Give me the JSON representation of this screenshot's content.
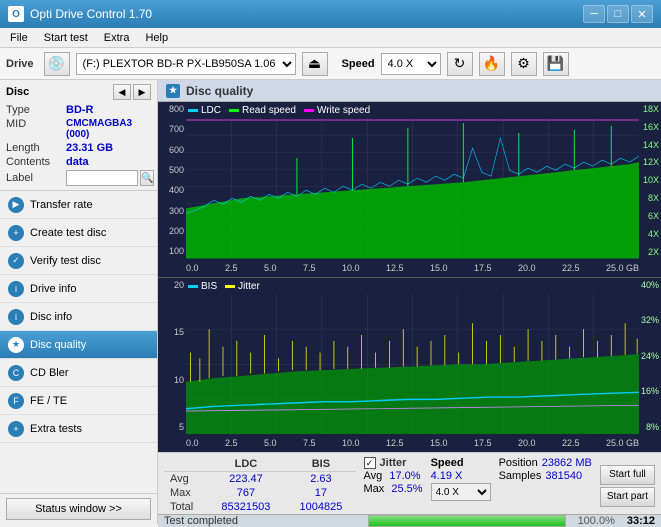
{
  "titlebar": {
    "title": "Opti Drive Control 1.70",
    "min_btn": "─",
    "max_btn": "□",
    "close_btn": "✕"
  },
  "menubar": {
    "items": [
      "File",
      "Start test",
      "Extra",
      "Help"
    ]
  },
  "toolbar": {
    "drive_label": "Drive",
    "drive_value": "(F:)  PLEXTOR BD-R  PX-LB950SA 1.06",
    "speed_label": "Speed",
    "speed_value": "4.0 X"
  },
  "disc": {
    "title": "Disc",
    "type_label": "Type",
    "type_value": "BD-R",
    "mid_label": "MID",
    "mid_value": "CMCMAGBA3 (000)",
    "length_label": "Length",
    "length_value": "23.31 GB",
    "contents_label": "Contents",
    "contents_value": "data",
    "label_label": "Label",
    "label_value": ""
  },
  "nav": {
    "items": [
      {
        "id": "transfer-rate",
        "label": "Transfer rate",
        "active": false
      },
      {
        "id": "create-test-disc",
        "label": "Create test disc",
        "active": false
      },
      {
        "id": "verify-test-disc",
        "label": "Verify test disc",
        "active": false
      },
      {
        "id": "drive-info",
        "label": "Drive info",
        "active": false
      },
      {
        "id": "disc-info",
        "label": "Disc info",
        "active": false
      },
      {
        "id": "disc-quality",
        "label": "Disc quality",
        "active": true
      },
      {
        "id": "cd-bler",
        "label": "CD Bler",
        "active": false
      },
      {
        "id": "fe-te",
        "label": "FE / TE",
        "active": false
      },
      {
        "id": "extra-tests",
        "label": "Extra tests",
        "active": false
      }
    ]
  },
  "status": {
    "btn_label": "Status window >>",
    "status_text": "Test completed",
    "progress_pct": 100,
    "time": "33:12"
  },
  "chart": {
    "title": "Disc quality",
    "top": {
      "legend": [
        {
          "id": "ldc",
          "label": "LDC",
          "color": "#00ccff"
        },
        {
          "id": "read-speed",
          "label": "Read speed",
          "color": "#00ff00"
        },
        {
          "id": "write-speed",
          "label": "Write speed",
          "color": "#ff00ff"
        }
      ],
      "y_left": [
        "800",
        "700",
        "600",
        "500",
        "400",
        "300",
        "200",
        "100"
      ],
      "y_right": [
        "18X",
        "16X",
        "14X",
        "12X",
        "10X",
        "8X",
        "6X",
        "4X",
        "2X"
      ],
      "x_labels": [
        "0.0",
        "2.5",
        "5.0",
        "7.5",
        "10.0",
        "12.5",
        "15.0",
        "17.5",
        "20.0",
        "22.5",
        "25.0 GB"
      ]
    },
    "bottom": {
      "legend": [
        {
          "id": "bis",
          "label": "BIS",
          "color": "#00ccff"
        },
        {
          "id": "jitter",
          "label": "Jitter",
          "color": "#ffff00"
        }
      ],
      "y_left": [
        "20",
        "15",
        "10",
        "5"
      ],
      "y_right": [
        "40%",
        "32%",
        "24%",
        "16%",
        "8%"
      ],
      "x_labels": [
        "0.0",
        "2.5",
        "5.0",
        "7.5",
        "10.0",
        "12.5",
        "15.0",
        "17.5",
        "20.0",
        "22.5",
        "25.0 GB"
      ]
    }
  },
  "stats": {
    "col_ldc": "LDC",
    "col_bis": "BIS",
    "col_jitter": "Jitter",
    "col_speed": "Speed",
    "avg_label": "Avg",
    "avg_ldc": "223.47",
    "avg_bis": "2.63",
    "avg_jitter": "17.0%",
    "avg_speed": "4.19 X",
    "max_label": "Max",
    "max_ldc": "767",
    "max_bis": "17",
    "max_jitter": "25.5%",
    "max_speed": "4.0 X",
    "total_label": "Total",
    "total_ldc": "85321503",
    "total_bis": "1004825",
    "position_label": "Position",
    "position_value": "23862 MB",
    "samples_label": "Samples",
    "samples_value": "381540",
    "start_full_btn": "Start full",
    "start_part_btn": "Start part"
  }
}
